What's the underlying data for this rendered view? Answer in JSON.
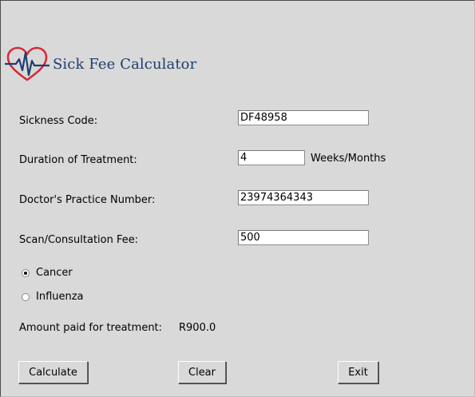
{
  "header": {
    "title": "Sick Fee Calculator",
    "logo_icon": "heart-pulse-icon",
    "colors": {
      "title": "#1d3e6e",
      "logo_heart": "#d42c3c",
      "logo_pulse": "#1d3e6e"
    }
  },
  "form": {
    "sickness_code": {
      "label": "Sickness Code:",
      "value": "DF48958"
    },
    "duration": {
      "label": "Duration of Treatment:",
      "value": "4",
      "unit": "Weeks/Months"
    },
    "practice_number": {
      "label": "Doctor's Practice Number:",
      "value": "23974364343"
    },
    "fee": {
      "label": "Scan/Consultation Fee:",
      "value": "500"
    },
    "options": [
      {
        "label": "Cancer",
        "selected": true
      },
      {
        "label": "Influenza",
        "selected": false
      }
    ],
    "result": {
      "label": "Amount paid for treatment:",
      "value": "R900.0"
    }
  },
  "buttons": {
    "calculate": "Calculate",
    "clear": "Clear",
    "exit": "Exit"
  }
}
